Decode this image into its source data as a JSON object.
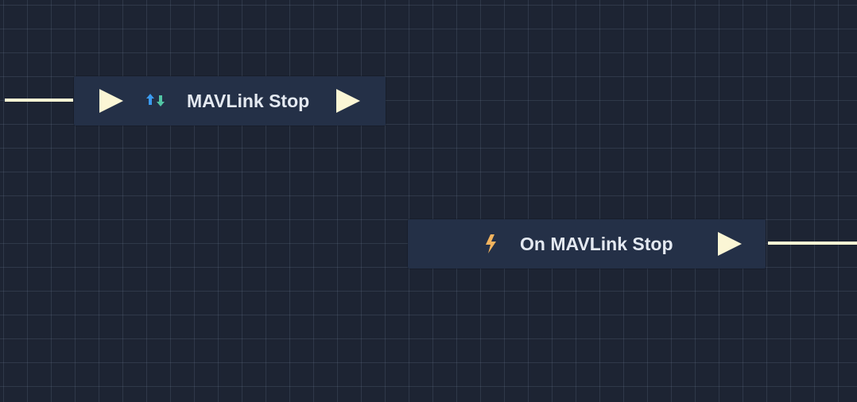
{
  "graph": {
    "nodes": [
      {
        "id": "mavlink-stop",
        "label": "MAVLink Stop",
        "icon": "up-down-arrows-icon",
        "has_input_exec": true,
        "has_output_exec": true
      },
      {
        "id": "on-mavlink-stop",
        "label": "On MAVLink Stop",
        "icon": "lightning-bolt-icon",
        "has_input_exec": false,
        "has_output_exec": true
      }
    ]
  },
  "colors": {
    "canvas_background": "#1d2433",
    "grid_line": "#3c4a5a",
    "node_background": "#243047",
    "exec_pin": "#fbf6d5",
    "wire": "#fbf6d5",
    "arrow_up": "#3b9bf0",
    "arrow_down": "#52c5a5",
    "lightning": "#f2b35e",
    "label_text": "#e4e9f1"
  }
}
